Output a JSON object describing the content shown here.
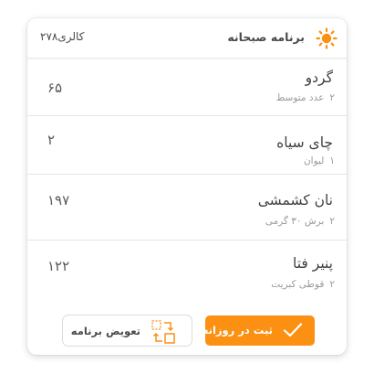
{
  "header": {
    "title": "برنامه صبحانه",
    "calories": "کالری۲۷۸",
    "icon": "sun-icon"
  },
  "items": [
    {
      "name": "گردو",
      "qty": "۲",
      "unit": "عدد متوسط",
      "calories": "۶۵"
    },
    {
      "name": "چای سیاه",
      "qty": "۱",
      "unit": "لیوان",
      "calories": "۲"
    },
    {
      "name": "نان کشمشی",
      "qty": "۲",
      "unit": "برش ۳۰ گرمی",
      "calories": "۱۹۷"
    },
    {
      "name": "پنیر فتا",
      "qty": "۲",
      "unit": "قوطی کبریت",
      "calories": "۱۲۲"
    }
  ],
  "actions": {
    "submit_label": "ثبت در روزانه",
    "swap_label": "تعویض برنامه"
  },
  "colors": {
    "accent": "#fb9013",
    "text": "#3f3f3f",
    "muted": "#9a9a9a"
  }
}
